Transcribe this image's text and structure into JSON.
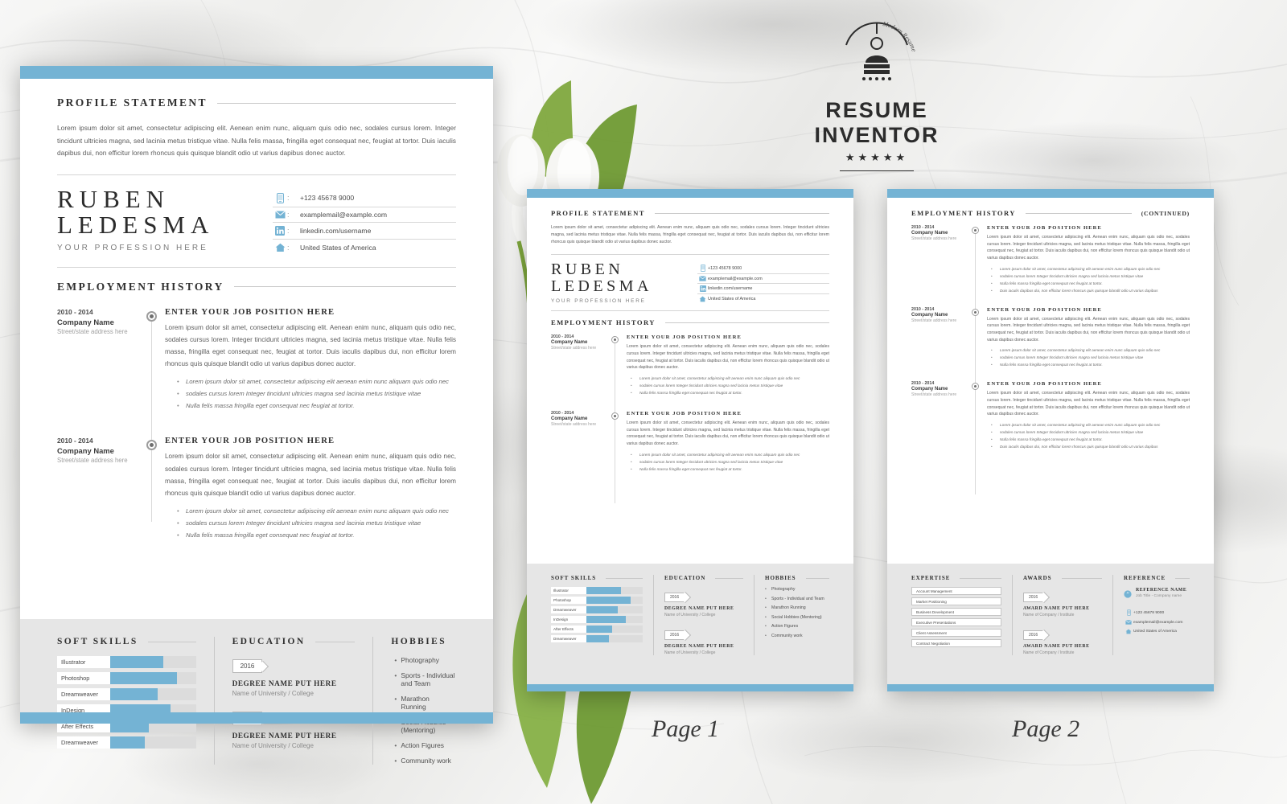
{
  "brand": {
    "logo_title": "RESUME INVENTOR",
    "logo_arc_text": "Modern Resume Design",
    "stars": "★★★★★"
  },
  "labels": {
    "page1": "Page 1",
    "page2": "Page 2"
  },
  "sections": {
    "profile": "PROFILE STATEMENT",
    "employment": "EMPLOYMENT HISTORY",
    "employment_continued": "(CONTINUED)",
    "soft_skills": "SOFT SKILLS",
    "education": "EDUCATION",
    "hobbies": "HOBBIES",
    "expertise": "EXPERTISE",
    "awards": "AWARDS",
    "reference": "REFERENCE"
  },
  "profile_text": "Lorem ipsum dolor sit amet, consectetur adipiscing elit. Aenean enim nunc, aliquam quis odio nec, sodales cursus lorem. Integer tincidunt ultricies magna, sed lacinia metus tristique vitae. Nulla felis massa, fringilla eget consequat nec, feugiat at tortor. Duis iaculis dapibus dui, non efficitur lorem rhoncus quis quisque blandit odio ut varius dapibus donec auctor.",
  "identity": {
    "first_name": "RUBEN",
    "last_name": "LEDESMA",
    "profession": "YOUR PROFESSION HERE"
  },
  "contacts": [
    {
      "icon": "phone-icon",
      "separator": ":",
      "value": "+123 45678 9000"
    },
    {
      "icon": "email-icon",
      "separator": ":",
      "value": "examplemail@example.com"
    },
    {
      "icon": "linkedin-icon",
      "separator": ":",
      "value": "linkedin.com/username"
    },
    {
      "icon": "home-icon",
      "separator": ":",
      "value": "United States of America"
    }
  ],
  "jobs": [
    {
      "years": "2010 - 2014",
      "company": "Company Name",
      "address": "Street/state address here",
      "title": "ENTER YOUR JOB POSITION HERE",
      "description": "Lorem ipsum dolor sit amet, consectetur adipiscing elit. Aenean enim nunc, aliquam quis odio nec, sodales cursus lorem. Integer tincidunt ultricies magna, sed lacinia metus tristique vitae. Nulla felis massa, fringilla eget consequat nec, feugiat at tortor. Duis iaculis dapibus dui, non efficitur lorem rhoncus quis quisque blandit odio ut varius dapibus donec auctor.",
      "bullets": [
        "Lorem ipsum dolor sit amet, consectetur adipiscing elit aenean enim nunc aliquam quis odio nec",
        "sodales cursus lorem Integer tincidunt ultricies magna sed lacinia metus tristique vitae",
        "Nulla felis massa fringilla eget consequat nec feugiat at tortor."
      ]
    },
    {
      "years": "2010 - 2014",
      "company": "Company Name",
      "address": "Street/state address here",
      "title": "ENTER YOUR JOB POSITION HERE",
      "description": "Lorem ipsum dolor sit amet, consectetur adipiscing elit. Aenean enim nunc, aliquam quis odio nec, sodales cursus lorem. Integer tincidunt ultricies magna, sed lacinia metus tristique vitae. Nulla felis massa, fringilla eget consequat nec, feugiat at tortor. Duis iaculis dapibus dui, non efficitur lorem rhoncus quis quisque blandit odio ut varius dapibus donec auctor.",
      "bullets": [
        "Lorem ipsum dolor sit amet, consectetur adipiscing elit aenean enim nunc aliquam quis odio nec",
        "sodales cursus lorem Integer tincidunt ultricies magna sed lacinia metus tristique vitae",
        "Nulla felis massa fringilla eget consequat nec feugiat at tortor."
      ]
    },
    {
      "years": "2010 - 2014",
      "company": "Company Name",
      "address": "Street/state address here",
      "title": "ENTER YOUR JOB POSITION HERE",
      "description": "Lorem ipsum dolor sit amet, consectetur adipiscing elit. Aenean enim nunc, aliquam quis odio nec, sodales cursus lorem. Integer tincidunt ultricies magna, sed lacinia metus tristique vitae. Nulla felis massa, fringilla eget consequat nec, feugiat at tortor. Duis iaculis dapibus dui, non efficitur lorem rhoncus quis quisque blandit odio ut varius dapibus donec auctor.",
      "bullets": [
        "Lorem ipsum dolor sit amet, consectetur adipiscing elit aenean enim nunc aliquam quis odio nec",
        "sodales cursus lorem Integer tincidunt ultricies magna sed lacinia metus tristique vitae",
        "Nulla felis massa fringilla eget consequat nec feugiat at tortor.",
        "Duis iaculis dapibus dui, non efficitur lorem rhoncus quis quisque blandit odio ut varius dapibus"
      ]
    }
  ],
  "skills": [
    {
      "name": "Illustrator",
      "percent": 62
    },
    {
      "name": "Photoshop",
      "percent": 78
    },
    {
      "name": "Dreamweaver",
      "percent": 55
    },
    {
      "name": "InDesign",
      "percent": 70
    },
    {
      "name": "After Effects",
      "percent": 45
    },
    {
      "name": "Dreamweaver",
      "percent": 40
    }
  ],
  "education": [
    {
      "year": "2016",
      "degree": "DEGREE NAME PUT HERE",
      "school": "Name of University / College"
    },
    {
      "year": "2016",
      "degree": "DEGREE NAME PUT HERE",
      "school": "Name of University / College"
    }
  ],
  "hobbies": [
    "Photography",
    "Sports - Individual and Team",
    "Marathon Running",
    "Social Hobbies (Mentoring)",
    "Action Figures",
    "Community work"
  ],
  "expertise": [
    "Account Management",
    "Market Positioning",
    "Business Development",
    "Executive Presentations",
    "Client Assessment",
    "Contract Negotiation"
  ],
  "awards": [
    {
      "year": "2016",
      "title": "AWARD NAME PUT HERE",
      "org": "Name of Company / Institute"
    },
    {
      "year": "2016",
      "title": "AWARD NAME PUT HERE",
      "org": "Name of Company / Institute"
    }
  ],
  "reference": {
    "name": "REFERENCE NAME",
    "role": "Job Title - Company name",
    "contacts": [
      {
        "icon": "phone-icon",
        "value": "+123 45678 9000"
      },
      {
        "icon": "email-icon",
        "value": "examplemail@example.com"
      },
      {
        "icon": "home-icon",
        "value": "United States of America"
      }
    ]
  },
  "colors": {
    "accent": "#74b3d4",
    "band": "#e6e6e6",
    "text": "#2f2f2f"
  }
}
